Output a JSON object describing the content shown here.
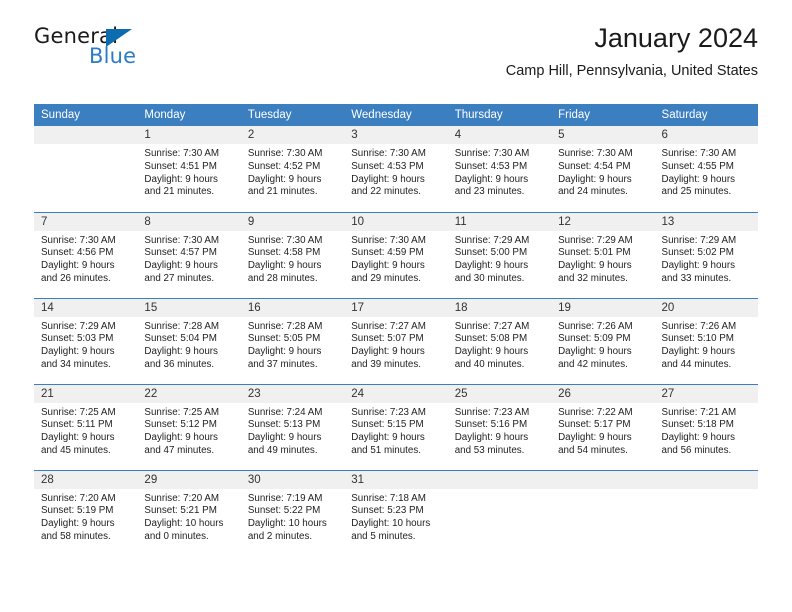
{
  "brand": {
    "name_part1": "General",
    "name_part2": "Blue",
    "logo_icon": "blue-triangle-icon",
    "accent_color": "#2b7cc4",
    "triangle_color": "#0d6cb0"
  },
  "header": {
    "title": "January 2024",
    "subtitle": "Camp Hill, Pennsylvania, United States"
  },
  "calendar": {
    "header_bg": "#3c7fc1",
    "daynum_bg": "#f0f0f0",
    "weekday_headers": [
      "Sunday",
      "Monday",
      "Tuesday",
      "Wednesday",
      "Thursday",
      "Friday",
      "Saturday"
    ],
    "weeks": [
      [
        {
          "day": "",
          "sunrise": "",
          "sunset": "",
          "daylight_line1": "",
          "daylight_line2": ""
        },
        {
          "day": "1",
          "sunrise": "Sunrise: 7:30 AM",
          "sunset": "Sunset: 4:51 PM",
          "daylight_line1": "Daylight: 9 hours",
          "daylight_line2": "and 21 minutes."
        },
        {
          "day": "2",
          "sunrise": "Sunrise: 7:30 AM",
          "sunset": "Sunset: 4:52 PM",
          "daylight_line1": "Daylight: 9 hours",
          "daylight_line2": "and 21 minutes."
        },
        {
          "day": "3",
          "sunrise": "Sunrise: 7:30 AM",
          "sunset": "Sunset: 4:53 PM",
          "daylight_line1": "Daylight: 9 hours",
          "daylight_line2": "and 22 minutes."
        },
        {
          "day": "4",
          "sunrise": "Sunrise: 7:30 AM",
          "sunset": "Sunset: 4:53 PM",
          "daylight_line1": "Daylight: 9 hours",
          "daylight_line2": "and 23 minutes."
        },
        {
          "day": "5",
          "sunrise": "Sunrise: 7:30 AM",
          "sunset": "Sunset: 4:54 PM",
          "daylight_line1": "Daylight: 9 hours",
          "daylight_line2": "and 24 minutes."
        },
        {
          "day": "6",
          "sunrise": "Sunrise: 7:30 AM",
          "sunset": "Sunset: 4:55 PM",
          "daylight_line1": "Daylight: 9 hours",
          "daylight_line2": "and 25 minutes."
        }
      ],
      [
        {
          "day": "7",
          "sunrise": "Sunrise: 7:30 AM",
          "sunset": "Sunset: 4:56 PM",
          "daylight_line1": "Daylight: 9 hours",
          "daylight_line2": "and 26 minutes."
        },
        {
          "day": "8",
          "sunrise": "Sunrise: 7:30 AM",
          "sunset": "Sunset: 4:57 PM",
          "daylight_line1": "Daylight: 9 hours",
          "daylight_line2": "and 27 minutes."
        },
        {
          "day": "9",
          "sunrise": "Sunrise: 7:30 AM",
          "sunset": "Sunset: 4:58 PM",
          "daylight_line1": "Daylight: 9 hours",
          "daylight_line2": "and 28 minutes."
        },
        {
          "day": "10",
          "sunrise": "Sunrise: 7:30 AM",
          "sunset": "Sunset: 4:59 PM",
          "daylight_line1": "Daylight: 9 hours",
          "daylight_line2": "and 29 minutes."
        },
        {
          "day": "11",
          "sunrise": "Sunrise: 7:29 AM",
          "sunset": "Sunset: 5:00 PM",
          "daylight_line1": "Daylight: 9 hours",
          "daylight_line2": "and 30 minutes."
        },
        {
          "day": "12",
          "sunrise": "Sunrise: 7:29 AM",
          "sunset": "Sunset: 5:01 PM",
          "daylight_line1": "Daylight: 9 hours",
          "daylight_line2": "and 32 minutes."
        },
        {
          "day": "13",
          "sunrise": "Sunrise: 7:29 AM",
          "sunset": "Sunset: 5:02 PM",
          "daylight_line1": "Daylight: 9 hours",
          "daylight_line2": "and 33 minutes."
        }
      ],
      [
        {
          "day": "14",
          "sunrise": "Sunrise: 7:29 AM",
          "sunset": "Sunset: 5:03 PM",
          "daylight_line1": "Daylight: 9 hours",
          "daylight_line2": "and 34 minutes."
        },
        {
          "day": "15",
          "sunrise": "Sunrise: 7:28 AM",
          "sunset": "Sunset: 5:04 PM",
          "daylight_line1": "Daylight: 9 hours",
          "daylight_line2": "and 36 minutes."
        },
        {
          "day": "16",
          "sunrise": "Sunrise: 7:28 AM",
          "sunset": "Sunset: 5:05 PM",
          "daylight_line1": "Daylight: 9 hours",
          "daylight_line2": "and 37 minutes."
        },
        {
          "day": "17",
          "sunrise": "Sunrise: 7:27 AM",
          "sunset": "Sunset: 5:07 PM",
          "daylight_line1": "Daylight: 9 hours",
          "daylight_line2": "and 39 minutes."
        },
        {
          "day": "18",
          "sunrise": "Sunrise: 7:27 AM",
          "sunset": "Sunset: 5:08 PM",
          "daylight_line1": "Daylight: 9 hours",
          "daylight_line2": "and 40 minutes."
        },
        {
          "day": "19",
          "sunrise": "Sunrise: 7:26 AM",
          "sunset": "Sunset: 5:09 PM",
          "daylight_line1": "Daylight: 9 hours",
          "daylight_line2": "and 42 minutes."
        },
        {
          "day": "20",
          "sunrise": "Sunrise: 7:26 AM",
          "sunset": "Sunset: 5:10 PM",
          "daylight_line1": "Daylight: 9 hours",
          "daylight_line2": "and 44 minutes."
        }
      ],
      [
        {
          "day": "21",
          "sunrise": "Sunrise: 7:25 AM",
          "sunset": "Sunset: 5:11 PM",
          "daylight_line1": "Daylight: 9 hours",
          "daylight_line2": "and 45 minutes."
        },
        {
          "day": "22",
          "sunrise": "Sunrise: 7:25 AM",
          "sunset": "Sunset: 5:12 PM",
          "daylight_line1": "Daylight: 9 hours",
          "daylight_line2": "and 47 minutes."
        },
        {
          "day": "23",
          "sunrise": "Sunrise: 7:24 AM",
          "sunset": "Sunset: 5:13 PM",
          "daylight_line1": "Daylight: 9 hours",
          "daylight_line2": "and 49 minutes."
        },
        {
          "day": "24",
          "sunrise": "Sunrise: 7:23 AM",
          "sunset": "Sunset: 5:15 PM",
          "daylight_line1": "Daylight: 9 hours",
          "daylight_line2": "and 51 minutes."
        },
        {
          "day": "25",
          "sunrise": "Sunrise: 7:23 AM",
          "sunset": "Sunset: 5:16 PM",
          "daylight_line1": "Daylight: 9 hours",
          "daylight_line2": "and 53 minutes."
        },
        {
          "day": "26",
          "sunrise": "Sunrise: 7:22 AM",
          "sunset": "Sunset: 5:17 PM",
          "daylight_line1": "Daylight: 9 hours",
          "daylight_line2": "and 54 minutes."
        },
        {
          "day": "27",
          "sunrise": "Sunrise: 7:21 AM",
          "sunset": "Sunset: 5:18 PM",
          "daylight_line1": "Daylight: 9 hours",
          "daylight_line2": "and 56 minutes."
        }
      ],
      [
        {
          "day": "28",
          "sunrise": "Sunrise: 7:20 AM",
          "sunset": "Sunset: 5:19 PM",
          "daylight_line1": "Daylight: 9 hours",
          "daylight_line2": "and 58 minutes."
        },
        {
          "day": "29",
          "sunrise": "Sunrise: 7:20 AM",
          "sunset": "Sunset: 5:21 PM",
          "daylight_line1": "Daylight: 10 hours",
          "daylight_line2": "and 0 minutes."
        },
        {
          "day": "30",
          "sunrise": "Sunrise: 7:19 AM",
          "sunset": "Sunset: 5:22 PM",
          "daylight_line1": "Daylight: 10 hours",
          "daylight_line2": "and 2 minutes."
        },
        {
          "day": "31",
          "sunrise": "Sunrise: 7:18 AM",
          "sunset": "Sunset: 5:23 PM",
          "daylight_line1": "Daylight: 10 hours",
          "daylight_line2": "and 5 minutes."
        },
        {
          "day": "",
          "sunrise": "",
          "sunset": "",
          "daylight_line1": "",
          "daylight_line2": ""
        },
        {
          "day": "",
          "sunrise": "",
          "sunset": "",
          "daylight_line1": "",
          "daylight_line2": ""
        },
        {
          "day": "",
          "sunrise": "",
          "sunset": "",
          "daylight_line1": "",
          "daylight_line2": ""
        }
      ]
    ]
  }
}
